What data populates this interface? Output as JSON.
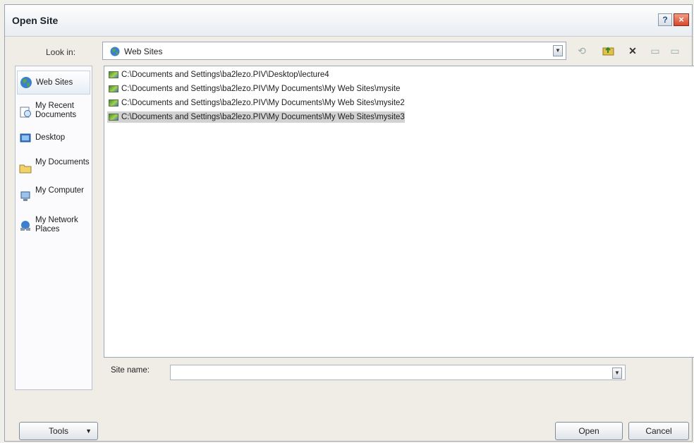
{
  "window": {
    "title": "Open Site"
  },
  "toolbar": {
    "lookin_label": "Look in:",
    "lookin_value": "Web Sites"
  },
  "places": [
    {
      "label": "Web Sites",
      "icon": "globe-icon",
      "selected": true
    },
    {
      "label": "My Recent Documents",
      "icon": "recent-documents-icon"
    },
    {
      "label": "Desktop",
      "icon": "desktop-icon"
    },
    {
      "label": "My Documents",
      "icon": "my-documents-icon"
    },
    {
      "label": "My Computer",
      "icon": "my-computer-icon"
    },
    {
      "label": "My Network Places",
      "icon": "network-places-icon"
    }
  ],
  "files": [
    {
      "path": "C:\\Documents and Settings\\ba2lezo.PIV\\Desktop\\lecture4"
    },
    {
      "path": "C:\\Documents and Settings\\ba2lezo.PIV\\My Documents\\My Web Sites\\mysite"
    },
    {
      "path": "C:\\Documents and Settings\\ba2lezo.PIV\\My Documents\\My Web Sites\\mysite2"
    },
    {
      "path": "C:\\Documents and Settings\\ba2lezo.PIV\\My Documents\\My Web Sites\\mysite3",
      "selected": true
    }
  ],
  "site_name": {
    "label": "Site name:",
    "value": ""
  },
  "buttons": {
    "tools": "Tools",
    "open": "Open",
    "cancel": "Cancel",
    "help": "?",
    "close": "×"
  }
}
